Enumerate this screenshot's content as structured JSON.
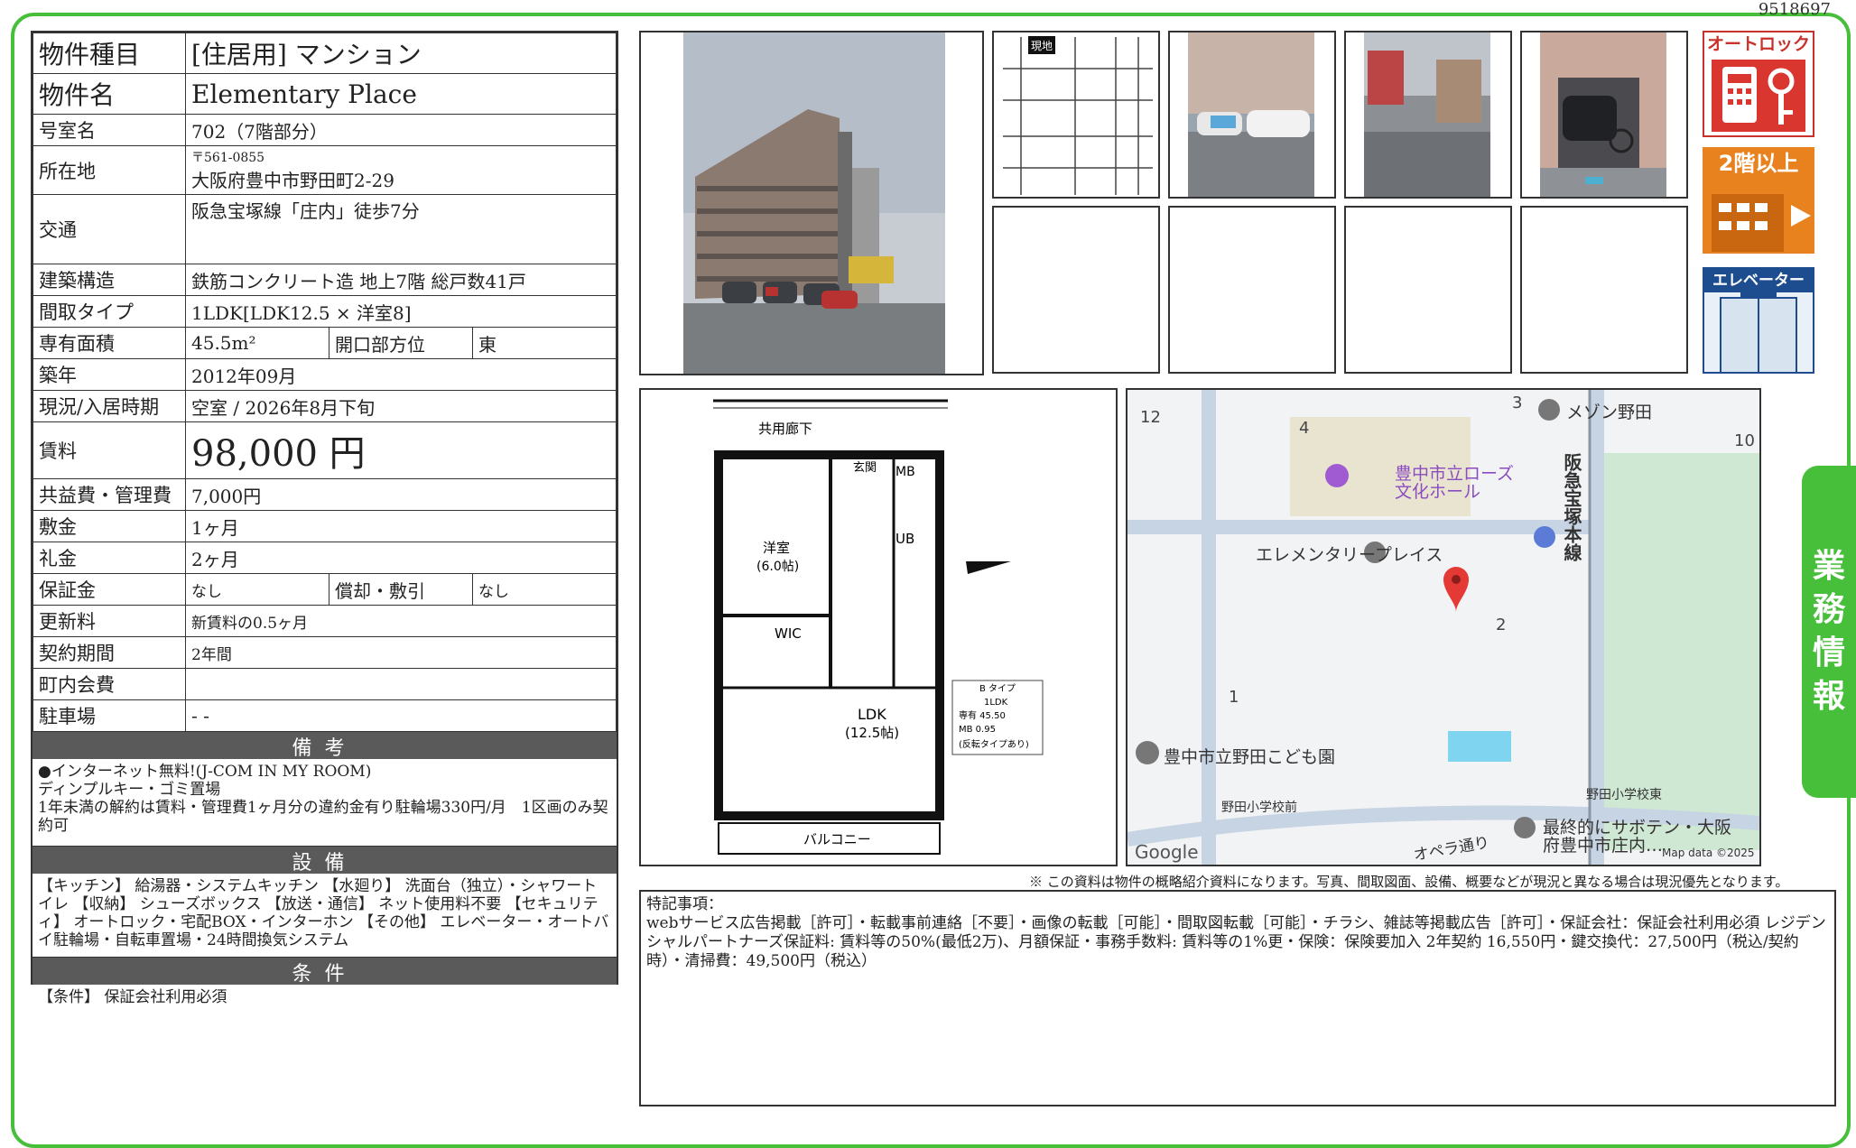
{
  "doc_id": "9518697",
  "rows": {
    "type_label": "物件種目",
    "type_value": "[住居用] マンション",
    "name_label": "物件名",
    "name_value": "Elementary Place",
    "room_label": "号室名",
    "room_value": "702（7階部分）",
    "address_label": "所在地",
    "postal": "〒561-0855",
    "address_value": "大阪府豊中市野田町2-29",
    "access_label": "交通",
    "access_value": "阪急宝塚線「庄内」徒歩7分",
    "structure_label": "建築構造",
    "structure_value": "鉄筋コンクリート造 地上7階 総戸数41戸",
    "layout_label": "間取タイプ",
    "layout_value": "1LDK[LDK12.5 × 洋室8]",
    "area_label": "専有面積",
    "area_value": "45.5m²",
    "direction_label": "開口部方位",
    "direction_value": "東",
    "built_label": "築年",
    "built_value": "2012年09月",
    "status_label": "現況/入居時期",
    "status_value": "空室 / 2026年8月下旬",
    "rent_label": "賃料",
    "rent_value": "98,000 円",
    "fee_label": "共益費・管理費",
    "fee_value": "7,000円",
    "deposit_label": "敷金",
    "deposit_value": "1ヶ月",
    "key_label": "礼金",
    "key_value": "2ヶ月",
    "guarantee_label": "保証金",
    "guarantee_value": "なし",
    "amort_label": "償却・敷引",
    "amort_value": "なし",
    "renewal_label": "更新料",
    "renewal_value": "新賃料の0.5ヶ月",
    "contract_label": "契約期間",
    "contract_value": "2年間",
    "community_label": "町内会費",
    "community_value": "",
    "parking_label": "駐車場",
    "parking_value": "- -"
  },
  "remarks": {
    "title": "備考",
    "lines": [
      "●インターネット無料!(J-COM IN MY ROOM)",
      "ディンプルキー・ゴミ置場",
      "1年未満の解約は賃料・管理費1ヶ月分の違約金有り駐輪場330円/月　1区画のみ契約可"
    ]
  },
  "facilities": {
    "title": "設備",
    "text": "【キッチン】 給湯器・システムキッチン 【水廻り】 洗面台（独立）・シャワートイレ 【収納】 シューズボックス 【放送・通信】 ネット使用料不要 【セキュリティ】 オートロック・宅配BOX・インターホン 【その他】 エレベーター・オートバイ駐輪場・自転車置場・24時間換気システム"
  },
  "conditions": {
    "title": "条件",
    "text": "【条件】 保証会社利用必須"
  },
  "icons": {
    "autolock": "オートロック",
    "floor": "2階以上",
    "elevator": "エレベーター"
  },
  "side_tab": [
    "業",
    "務",
    "情",
    "報"
  ],
  "notice": "※ この資料は物件の概略紹介資料になります。写真、間取図面、設備、概要などが現況と異なる場合は現況優先となります。",
  "special": {
    "title": "特記事項：",
    "text": "webサービス広告掲載［許可］・転載事前連絡［不要］・画像の転載［可能］・間取図転載［可能］・チラシ、雑誌等掲載広告［許可］・保証会社：保証会社利用必須 レジデンシャルパートナーズ保証料: 賃料等の50%(最低2万)、月額保証・事務手数料: 賃料等の1%更・保険：保険要加入 2年契約 16,550円・鍵交換代：27,500円（税込/契約時）・清掃費：49,500円（税込）"
  },
  "floorplan": {
    "corridor": "共用廊下",
    "entrance": "玄関",
    "mb": "MB",
    "ub": "UB",
    "western_room": "洋室",
    "western_size": "(6.0帖)",
    "wic": "WIC",
    "ldk": "LDK",
    "ldk_size": "(12.5帖)",
    "balcony": "バルコニー",
    "table": [
      "B タイプ",
      "1LDK",
      "専有 45.50",
      "MB 0.95",
      "(反転タイプあり)"
    ]
  },
  "map": {
    "labels": [
      "メゾン野田",
      "豊中市立ローズ",
      "文化ホール",
      "エレメンタリープレイス",
      "阪急宝塚本線",
      "豊中市立野田こども園",
      "野田小学校前",
      "野田小学校東",
      "最終的にサボテン・大阪",
      "府豊中市庄内…",
      "オペラ通り",
      "Google",
      "Map data ©2025",
      "現地"
    ],
    "numbers": [
      "12",
      "4",
      "3",
      "10",
      "2",
      "1"
    ]
  }
}
